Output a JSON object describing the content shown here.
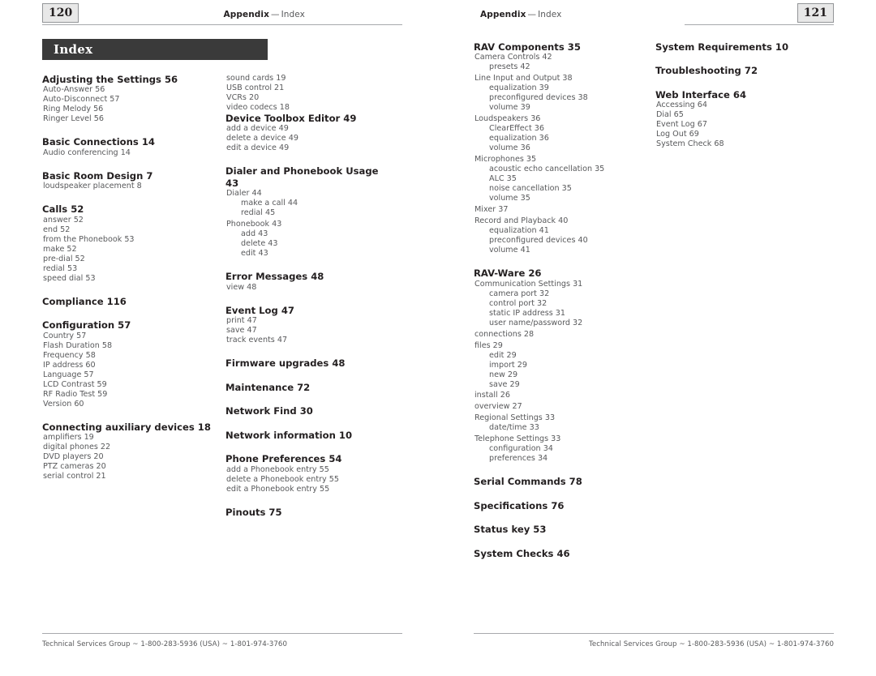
{
  "document": {
    "type": "index",
    "banner_title": "Index",
    "footer_text": "Technical Services Group ~ 1-800-283-5936 (USA) ~ 1-801-974-3760"
  },
  "left_page": {
    "folio": "120",
    "runhead_bold": "Appendix",
    "runhead_dash": "—",
    "runhead_light": "Index",
    "column1": [
      {
        "level": "h",
        "text": "Adjusting the Settings 56",
        "gap_before": "none"
      },
      {
        "level": "1",
        "text": "Auto-Answer 56",
        "gap_before": "none"
      },
      {
        "level": "1",
        "text": "Auto-Disconnect 57",
        "gap_before": "none"
      },
      {
        "level": "1",
        "text": "Ring Melody 56",
        "gap_before": "none"
      },
      {
        "level": "1",
        "text": "Ringer Level 56",
        "gap_before": "none"
      },
      {
        "level": "h",
        "text": "Basic Connections 14",
        "gap_before": "head"
      },
      {
        "level": "1",
        "text": "Audio conferencing 14",
        "gap_before": "none"
      },
      {
        "level": "h",
        "text": "Basic Room Design  7",
        "gap_before": "head"
      },
      {
        "level": "1",
        "text": "loudspeaker placement 8",
        "gap_before": "none"
      },
      {
        "level": "h",
        "text": "Calls 52",
        "gap_before": "head"
      },
      {
        "level": "1",
        "text": "answer 52",
        "gap_before": "none"
      },
      {
        "level": "1",
        "text": "end 52",
        "gap_before": "none"
      },
      {
        "level": "1",
        "text": "from the Phonebook 53",
        "gap_before": "none"
      },
      {
        "level": "1",
        "text": "make 52",
        "gap_before": "none"
      },
      {
        "level": "1",
        "text": "pre-dial 52",
        "gap_before": "none"
      },
      {
        "level": "1",
        "text": "redial 53",
        "gap_before": "none"
      },
      {
        "level": "1",
        "text": "speed dial 53",
        "gap_before": "none"
      },
      {
        "level": "h",
        "text": "Compliance 116",
        "gap_before": "head"
      },
      {
        "level": "h",
        "text": "Configuration 57",
        "gap_before": "head"
      },
      {
        "level": "1",
        "text": "Country 57",
        "gap_before": "none"
      },
      {
        "level": "1",
        "text": "Flash Duration 58",
        "gap_before": "none"
      },
      {
        "level": "1",
        "text": "Frequency 58",
        "gap_before": "none"
      },
      {
        "level": "1",
        "text": "IP address 60",
        "gap_before": "none"
      },
      {
        "level": "1",
        "text": "Language 57",
        "gap_before": "none"
      },
      {
        "level": "1",
        "text": "LCD Contrast 59",
        "gap_before": "none"
      },
      {
        "level": "1",
        "text": "RF Radio Test 59",
        "gap_before": "none"
      },
      {
        "level": "1",
        "text": "Version 60",
        "gap_before": "none"
      },
      {
        "level": "h",
        "text": "Connecting auxiliary devices 18",
        "gap_before": "head"
      },
      {
        "level": "1",
        "text": "amplifiers 19",
        "gap_before": "none"
      },
      {
        "level": "1",
        "text": "digital phones 22",
        "gap_before": "none"
      },
      {
        "level": "1",
        "text": "DVD players 20",
        "gap_before": "none"
      },
      {
        "level": "1",
        "text": "PTZ cameras 20",
        "gap_before": "none"
      },
      {
        "level": "1",
        "text": "serial control 21",
        "gap_before": "none"
      }
    ],
    "column2": [
      {
        "level": "1",
        "text": "sound cards 19",
        "gap_before": "none"
      },
      {
        "level": "1",
        "text": "USB control 21",
        "gap_before": "none"
      },
      {
        "level": "1",
        "text": "VCRs 20",
        "gap_before": "none"
      },
      {
        "level": "1",
        "text": "video codecs 18",
        "gap_before": "none"
      },
      {
        "level": "h",
        "text": "Device Toolbox Editor 49",
        "gap_before": "none"
      },
      {
        "level": "1",
        "text": "add a device 49",
        "gap_before": "none"
      },
      {
        "level": "1",
        "text": "delete a device 49",
        "gap_before": "none"
      },
      {
        "level": "1",
        "text": "edit a device 49",
        "gap_before": "none"
      },
      {
        "level": "h",
        "text": "Dialer and Phonebook Usage 43",
        "gap_before": "head"
      },
      {
        "level": "1",
        "text": "Dialer 44",
        "gap_before": "none"
      },
      {
        "level": "2",
        "text": "make a call 44",
        "gap_before": "none"
      },
      {
        "level": "2",
        "text": "redial 45",
        "gap_before": "none"
      },
      {
        "level": "1",
        "text": "Phonebook 43",
        "gap_before": "entry"
      },
      {
        "level": "2",
        "text": "add 43",
        "gap_before": "none"
      },
      {
        "level": "2",
        "text": "delete 43",
        "gap_before": "none"
      },
      {
        "level": "2",
        "text": "edit 43",
        "gap_before": "none"
      },
      {
        "level": "h",
        "text": "Error Messages 48",
        "gap_before": "head"
      },
      {
        "level": "1",
        "text": "view 48",
        "gap_before": "none"
      },
      {
        "level": "h",
        "text": "Event Log 47",
        "gap_before": "head"
      },
      {
        "level": "1",
        "text": "print 47",
        "gap_before": "none"
      },
      {
        "level": "1",
        "text": "save 47",
        "gap_before": "none"
      },
      {
        "level": "1",
        "text": "track events 47",
        "gap_before": "none"
      },
      {
        "level": "h",
        "text": "Firmware upgrades 48",
        "gap_before": "head"
      },
      {
        "level": "h",
        "text": "Maintenance 72",
        "gap_before": "head"
      },
      {
        "level": "h",
        "text": "Network Find 30",
        "gap_before": "head"
      },
      {
        "level": "h",
        "text": "Network information 10",
        "gap_before": "head"
      },
      {
        "level": "h",
        "text": "Phone Preferences 54",
        "gap_before": "head"
      },
      {
        "level": "1",
        "text": "add a Phonebook entry 55",
        "gap_before": "none"
      },
      {
        "level": "1",
        "text": "delete a Phonebook entry 55",
        "gap_before": "none"
      },
      {
        "level": "1",
        "text": "edit a Phonebook entry 55",
        "gap_before": "none"
      },
      {
        "level": "h",
        "text": "Pinouts 75",
        "gap_before": "head"
      }
    ]
  },
  "right_page": {
    "folio": "121",
    "runhead_bold": "Appendix",
    "runhead_dash": "—",
    "runhead_light": "Index",
    "column1": [
      {
        "level": "h",
        "text": "RAV Components 35",
        "gap_before": "none"
      },
      {
        "level": "1",
        "text": "Camera Controls 42",
        "gap_before": "none"
      },
      {
        "level": "2",
        "text": "presets 42",
        "gap_before": "none"
      },
      {
        "level": "1",
        "text": "Line Input and Output 38",
        "gap_before": "entry"
      },
      {
        "level": "2",
        "text": "equalization 39",
        "gap_before": "none"
      },
      {
        "level": "2",
        "text": "preconfigured devices 38",
        "gap_before": "none"
      },
      {
        "level": "2",
        "text": "volume 39",
        "gap_before": "none"
      },
      {
        "level": "1",
        "text": "Loudspeakers 36",
        "gap_before": "entry"
      },
      {
        "level": "2",
        "text": "ClearEffect 36",
        "gap_before": "none"
      },
      {
        "level": "2",
        "text": "equalization 36",
        "gap_before": "none"
      },
      {
        "level": "2",
        "text": "volume 36",
        "gap_before": "none"
      },
      {
        "level": "1",
        "text": "Microphones 35",
        "gap_before": "entry"
      },
      {
        "level": "2",
        "text": "acoustic echo cancellation 35",
        "gap_before": "none"
      },
      {
        "level": "2",
        "text": "ALC 35",
        "gap_before": "none"
      },
      {
        "level": "2",
        "text": "noise cancellation 35",
        "gap_before": "none"
      },
      {
        "level": "2",
        "text": "volume 35",
        "gap_before": "none"
      },
      {
        "level": "1",
        "text": "Mixer 37",
        "gap_before": "entry"
      },
      {
        "level": "1",
        "text": "Record and Playback 40",
        "gap_before": "entry"
      },
      {
        "level": "2",
        "text": "equalization 41",
        "gap_before": "none"
      },
      {
        "level": "2",
        "text": "preconfigured devices 40",
        "gap_before": "none"
      },
      {
        "level": "2",
        "text": "volume 41",
        "gap_before": "none"
      },
      {
        "level": "h",
        "text": "RAV-Ware 26",
        "gap_before": "head"
      },
      {
        "level": "1",
        "text": "Communication Settings 31",
        "gap_before": "none"
      },
      {
        "level": "2",
        "text": "camera port 32",
        "gap_before": "none"
      },
      {
        "level": "2",
        "text": "control port 32",
        "gap_before": "none"
      },
      {
        "level": "2",
        "text": "static IP address 31",
        "gap_before": "none"
      },
      {
        "level": "2",
        "text": "user name/password 32",
        "gap_before": "none"
      },
      {
        "level": "1",
        "text": "connections 28",
        "gap_before": "entry"
      },
      {
        "level": "1",
        "text": "files 29",
        "gap_before": "entry"
      },
      {
        "level": "2",
        "text": "edit 29",
        "gap_before": "none"
      },
      {
        "level": "2",
        "text": "import 29",
        "gap_before": "none"
      },
      {
        "level": "2",
        "text": "new 29",
        "gap_before": "none"
      },
      {
        "level": "2",
        "text": "save 29",
        "gap_before": "none"
      },
      {
        "level": "1",
        "text": "install 26",
        "gap_before": "entry"
      },
      {
        "level": "1",
        "text": "overview 27",
        "gap_before": "entry"
      },
      {
        "level": "1",
        "text": "Regional Settings 33",
        "gap_before": "entry"
      },
      {
        "level": "2",
        "text": "date/time 33",
        "gap_before": "none"
      },
      {
        "level": "1",
        "text": "Telephone Settings 33",
        "gap_before": "entry"
      },
      {
        "level": "2",
        "text": "configuration 34",
        "gap_before": "none"
      },
      {
        "level": "2",
        "text": "preferences 34",
        "gap_before": "none"
      },
      {
        "level": "h",
        "text": "Serial Commands 78",
        "gap_before": "head"
      },
      {
        "level": "h",
        "text": "Specifications 76",
        "gap_before": "head"
      },
      {
        "level": "h",
        "text": "Status key 53",
        "gap_before": "head"
      },
      {
        "level": "h",
        "text": "System Checks 46",
        "gap_before": "head"
      }
    ],
    "column2": [
      {
        "level": "h",
        "text": "System Requirements 10",
        "gap_before": "none"
      },
      {
        "level": "h",
        "text": "Troubleshooting 72",
        "gap_before": "head"
      },
      {
        "level": "h",
        "text": "Web Interface 64",
        "gap_before": "head"
      },
      {
        "level": "1",
        "text": "Accessing 64",
        "gap_before": "none"
      },
      {
        "level": "1",
        "text": "Dial 65",
        "gap_before": "none"
      },
      {
        "level": "1",
        "text": "Event Log 67",
        "gap_before": "none"
      },
      {
        "level": "1",
        "text": "Log Out 69",
        "gap_before": "none"
      },
      {
        "level": "1",
        "text": "System Check 68",
        "gap_before": "none"
      }
    ]
  }
}
